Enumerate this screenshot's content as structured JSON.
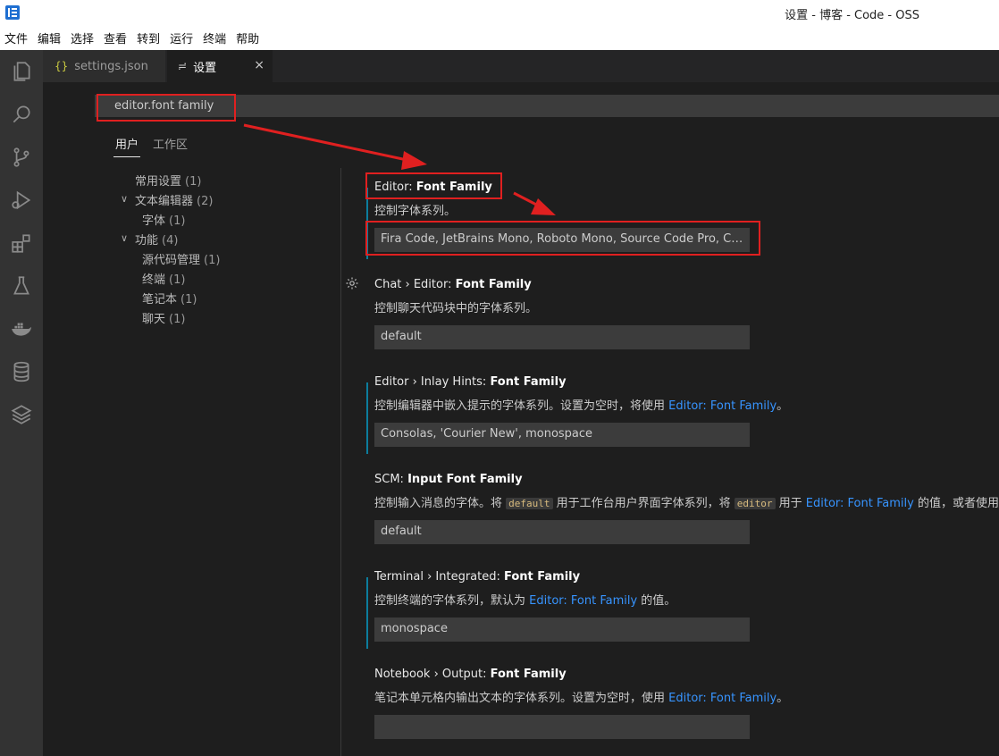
{
  "window": {
    "title": "设置 - 博客 - Code - OSS"
  },
  "menu": [
    "文件",
    "编辑",
    "选择",
    "查看",
    "转到",
    "运行",
    "终端",
    "帮助"
  ],
  "tabs": [
    {
      "icon": "{}",
      "label": "settings.json"
    },
    {
      "icon": "≓",
      "label": "设置",
      "close": "×"
    }
  ],
  "search": {
    "value": "editor.font family"
  },
  "scope_tabs": {
    "user": "用户",
    "workspace": "工作区"
  },
  "toc": [
    {
      "label": "常用设置",
      "count": "(1)"
    },
    {
      "label": "文本编辑器",
      "count": "(2)"
    },
    {
      "label": "字体",
      "count": "(1)"
    },
    {
      "label": "功能",
      "count": "(4)"
    },
    {
      "label": "源代码管理",
      "count": "(1)"
    },
    {
      "label": "终端",
      "count": "(1)"
    },
    {
      "label": "笔记本",
      "count": "(1)"
    },
    {
      "label": "聊天",
      "count": "(1)"
    }
  ],
  "settings": [
    {
      "prefix": "Editor: ",
      "name": "Font Family",
      "desc": "控制字体系列。",
      "value": "Fira Code, JetBrains Mono, Roboto Mono, Source Code Pro, Cons..."
    },
    {
      "prefix": "Chat › Editor: ",
      "name": "Font Family",
      "desc": "控制聊天代码块中的字体系列。",
      "value": "default"
    },
    {
      "prefix": "Editor › Inlay Hints: ",
      "name": "Font Family",
      "desc_a": "控制编辑器中嵌入提示的字体系列。设置为空时，将使用 ",
      "link": "Editor: Font Family",
      "desc_b": "。",
      "value": "Consolas, 'Courier New', monospace"
    },
    {
      "prefix": "SCM: ",
      "name": "Input Font Family",
      "desc_a": "控制输入消息的字体。将 ",
      "code1": "default",
      "desc_b": " 用于工作台用户界面字体系列，将 ",
      "code2": "editor",
      "desc_c": " 用于 ",
      "link": "Editor: Font Family",
      "desc_d": " 的值，或者使用自",
      "value": "default"
    },
    {
      "prefix": "Terminal › Integrated: ",
      "name": "Font Family",
      "desc_a": "控制终端的字体系列，默认为 ",
      "link": "Editor: Font Family",
      "desc_b": " 的值。",
      "value": "monospace"
    },
    {
      "prefix": "Notebook › Output: ",
      "name": "Font Family",
      "desc_a": "笔记本单元格内输出文本的字体系列。设置为空时，使用 ",
      "link": "Editor: Font Family",
      "desc_b": "。",
      "value": ""
    }
  ],
  "colors": {
    "annotation": "#e02020",
    "link": "#3794ff",
    "modified_bar": "#0c7d9d"
  }
}
